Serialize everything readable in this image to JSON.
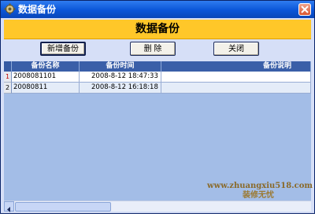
{
  "window": {
    "title": "数据备份",
    "icon": "app-gear-icon",
    "close_icon": "close-icon"
  },
  "banner": {
    "title": "数据备份"
  },
  "toolbar": {
    "add_label": "新增备份",
    "delete_label": "删  除",
    "close_label": "关闭"
  },
  "table": {
    "columns": [
      "备份名称",
      "备份时间",
      "备份说明"
    ],
    "rows": [
      {
        "num": "1",
        "name": "2008081101",
        "time": "2008-8-12 18:47:33",
        "note": ""
      },
      {
        "num": "2",
        "name": "20080811",
        "time": "2008-8-12 16:18:18",
        "note": ""
      }
    ]
  },
  "watermark": {
    "line1": "www.zhuangxiu518.com",
    "line2": "装修无忧"
  }
}
